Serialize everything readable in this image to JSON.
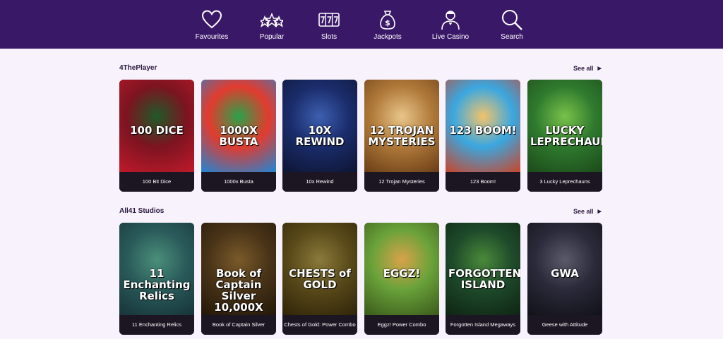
{
  "nav": {
    "items": [
      {
        "label": "Favourites",
        "icon": "heart-icon"
      },
      {
        "label": "Popular",
        "icon": "stars-icon"
      },
      {
        "label": "Slots",
        "icon": "slots-777-icon"
      },
      {
        "label": "Jackpots",
        "icon": "money-bag-icon"
      },
      {
        "label": "Live Casino",
        "icon": "dealer-icon"
      },
      {
        "label": "Search",
        "icon": "search-icon"
      }
    ]
  },
  "sections": [
    {
      "title": "4ThePlayer",
      "see_all": "See all",
      "games": [
        {
          "name": "100 Bit Dice",
          "logo": "100 DICE",
          "colors": [
            "#7c1420",
            "#1f5a28",
            "#c0192b"
          ]
        },
        {
          "name": "1000x Busta",
          "logo": "1000X BUSTA",
          "colors": [
            "#e23b2e",
            "#2aa24a",
            "#1e86d6"
          ]
        },
        {
          "name": "10x Rewind",
          "logo": "10X REWIND",
          "colors": [
            "#1a2c6b",
            "#3d5fb0",
            "#0e1533"
          ]
        },
        {
          "name": "12 Trojan Mysteries",
          "logo": "12 TROJAN MYSTERIES",
          "colors": [
            "#b07a3a",
            "#e8c58a",
            "#6a3d16"
          ]
        },
        {
          "name": "123 Boom!",
          "logo": "123 BOOM!",
          "colors": [
            "#3aa7e0",
            "#f2c36b",
            "#c9452a"
          ]
        },
        {
          "name": "3 Lucky Leprechauns",
          "logo": "LUCKY LEPRECHAUNS",
          "colors": [
            "#2f7a2e",
            "#79c24a",
            "#1c4a1a"
          ]
        }
      ]
    },
    {
      "title": "All41 Studios",
      "see_all": "See all",
      "games": [
        {
          "name": "11 Enchanting Relics",
          "logo": "11 Enchanting Relics",
          "colors": [
            "#2a5a5a",
            "#4a8f7a",
            "#16343a"
          ]
        },
        {
          "name": "Book of Captain Silver",
          "logo": "Book of Captain Silver 10,000X",
          "colors": [
            "#4a3418",
            "#7a5a2a",
            "#221708"
          ]
        },
        {
          "name": "Chests of Gold: Power Combo",
          "logo": "CHESTS of GOLD",
          "colors": [
            "#5a4a1a",
            "#8a7a3a",
            "#2e2408"
          ]
        },
        {
          "name": "Eggz! Power Combo",
          "logo": "EGGZ!",
          "colors": [
            "#6aa23a",
            "#d9a24a",
            "#3a5a1a"
          ]
        },
        {
          "name": "Forgotten Island Megaways",
          "logo": "FORGOTTEN ISLAND",
          "colors": [
            "#1e4a2a",
            "#4a8a3a",
            "#0e2414"
          ]
        },
        {
          "name": "Geese with Attitude",
          "logo": "GWA",
          "colors": [
            "#2a2a3a",
            "#5a5a6a",
            "#111118"
          ]
        }
      ]
    }
  ]
}
